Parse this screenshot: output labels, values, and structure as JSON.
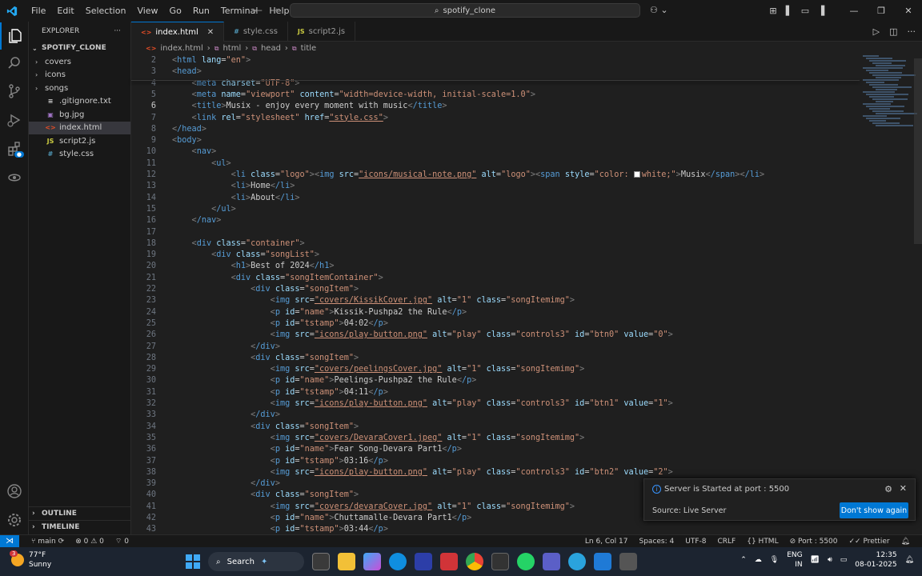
{
  "titlebar": {
    "menu": [
      "File",
      "Edit",
      "Selection",
      "View",
      "Go",
      "Run",
      "Terminal",
      "Help"
    ],
    "search_text": "spotify_clone"
  },
  "explorer": {
    "title": "EXPLORER",
    "project": "SPOTIFY_CLONE",
    "items": [
      {
        "label": "covers",
        "type": "folder"
      },
      {
        "label": "icons",
        "type": "folder"
      },
      {
        "label": "songs",
        "type": "folder"
      },
      {
        "label": ".gitignore.txt",
        "type": "txt"
      },
      {
        "label": "bg.jpg",
        "type": "img"
      },
      {
        "label": "index.html",
        "type": "html"
      },
      {
        "label": "script2.js",
        "type": "js"
      },
      {
        "label": "style.css",
        "type": "css"
      }
    ],
    "outline": "OUTLINE",
    "timeline": "TIMELINE"
  },
  "tabs": [
    {
      "label": "index.html",
      "icon": "<>"
    },
    {
      "label": "style.css",
      "icon": "#"
    },
    {
      "label": "script2.js",
      "icon": "JS"
    }
  ],
  "breadcrumb": [
    "index.html",
    "html",
    "head",
    "title"
  ],
  "code_lines": [
    {
      "n": "2",
      "text": "<html lang=\"en\">"
    },
    {
      "n": "3",
      "text": "<head>"
    },
    {
      "n": "4",
      "text": "    <meta charset=\"UTF-8\">"
    },
    {
      "n": "5",
      "text": "    <meta name=\"viewport\" content=\"width=device-width, initial-scale=1.0\">"
    },
    {
      "n": "6",
      "text": "    <title>Musix - enjoy every moment with music</title>"
    },
    {
      "n": "7",
      "text": "    <link rel=\"stylesheet\" href=\"style.css\">"
    },
    {
      "n": "8",
      "text": "</head>"
    },
    {
      "n": "9",
      "text": "<body>"
    },
    {
      "n": "10",
      "text": "    <nav>"
    },
    {
      "n": "11",
      "text": "        <ul>"
    },
    {
      "n": "12",
      "text": "            <li class=\"logo\"><img src=\"icons/musical-note.png\" alt=\"logo\"><span style=\"color: white;\">Musix</span></li>"
    },
    {
      "n": "13",
      "text": "            <li>Home</li>"
    },
    {
      "n": "14",
      "text": "            <li>About</li>"
    },
    {
      "n": "15",
      "text": "        </ul>"
    },
    {
      "n": "16",
      "text": "    </nav>"
    },
    {
      "n": "17",
      "text": ""
    },
    {
      "n": "18",
      "text": "    <div class=\"container\">"
    },
    {
      "n": "19",
      "text": "        <div class=\"songList\">"
    },
    {
      "n": "20",
      "text": "            <h1>Best of 2024</h1>"
    },
    {
      "n": "21",
      "text": "            <div class=\"songItemContainer\">"
    },
    {
      "n": "22",
      "text": "                <div class=\"songItem\">"
    },
    {
      "n": "23",
      "text": "                    <img src=\"covers/KissikCover.jpg\" alt=\"1\" class=\"songItemimg\">"
    },
    {
      "n": "24",
      "text": "                    <p id=\"name\">Kissik-Pushpa2 the Rule</p>"
    },
    {
      "n": "25",
      "text": "                    <p id=\"tstamp\">04:02</p>"
    },
    {
      "n": "26",
      "text": "                    <img src=\"icons/play-button.png\" alt=\"play\" class=\"controls3\" id=\"btn0\" value=\"0\">"
    },
    {
      "n": "27",
      "text": "                </div>"
    },
    {
      "n": "28",
      "text": "                <div class=\"songItem\">"
    },
    {
      "n": "29",
      "text": "                    <img src=\"covers/peelingsCover.jpg\" alt=\"1\" class=\"songItemimg\">"
    },
    {
      "n": "30",
      "text": "                    <p id=\"name\">Peelings-Pushpa2 the Rule</p>"
    },
    {
      "n": "31",
      "text": "                    <p id=\"tstamp\">04:11</p>"
    },
    {
      "n": "32",
      "text": "                    <img src=\"icons/play-button.png\" alt=\"play\" class=\"controls3\" id=\"btn1\" value=\"1\">"
    },
    {
      "n": "33",
      "text": "                </div>"
    },
    {
      "n": "34",
      "text": "                <div class=\"songItem\">"
    },
    {
      "n": "35",
      "text": "                    <img src=\"covers/DevaraCover1.jpeg\" alt=\"1\" class=\"songItemimg\">"
    },
    {
      "n": "36",
      "text": "                    <p id=\"name\">Fear Song-Devara Part1</p>"
    },
    {
      "n": "37",
      "text": "                    <p id=\"tstamp\">03:16</p>"
    },
    {
      "n": "38",
      "text": "                    <img src=\"icons/play-button.png\" alt=\"play\" class=\"controls3\" id=\"btn2\" value=\"2\">"
    },
    {
      "n": "39",
      "text": "                </div>"
    },
    {
      "n": "40",
      "text": "                <div class=\"songItem\">"
    },
    {
      "n": "41",
      "text": "                    <img src=\"covers/devaraCover.jpg\" alt=\"1\" class=\"songItemimg\">"
    },
    {
      "n": "42",
      "text": "                    <p id=\"name\">Chuttamalle-Devara Part1</p>"
    },
    {
      "n": "43",
      "text": "                    <p id=\"tstamp\">03:44</p>"
    }
  ],
  "notification": {
    "message": "Server is Started at port : 5500",
    "source": "Source: Live Server",
    "button": "Don't show again"
  },
  "statusbar": {
    "branch": "main",
    "problems": "0",
    "warnings": "0",
    "ports": "0",
    "cursor": "Ln 6, Col 17",
    "spaces": "Spaces: 4",
    "encoding": "UTF-8",
    "eol": "CRLF",
    "language": "HTML",
    "port": "Port : 5500",
    "formatter": "Prettier"
  },
  "taskbar": {
    "weather_temp": "77°F",
    "weather_desc": "Sunny",
    "weather_badge": "3",
    "search": "Search",
    "lang": "ENG",
    "region": "IN",
    "time": "12:35",
    "date": "08-01-2025"
  },
  "colors": {
    "accent": "#0078d4",
    "tag": "#569cd6",
    "attr": "#9cdcfe",
    "string": "#ce9178"
  }
}
